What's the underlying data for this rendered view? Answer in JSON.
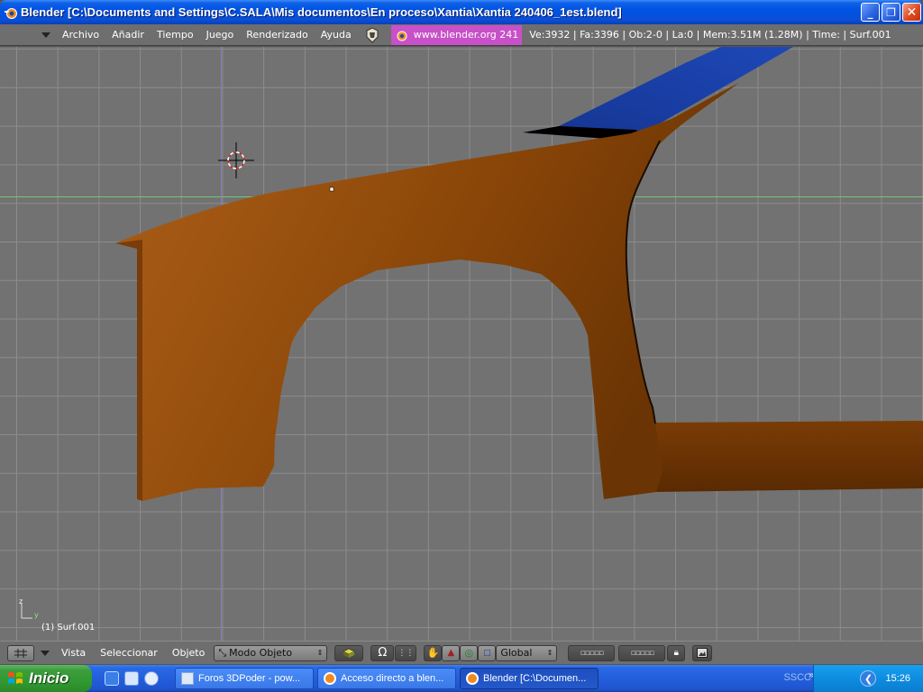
{
  "window": {
    "title": "Blender [C:\\Documents and Settings\\C.SALA\\Mis documentos\\En proceso\\Xantia\\Xantia 240406_1est.blend]",
    "minimize_label": "_",
    "maximize_label": "❐",
    "close_label": "✕"
  },
  "info_header": {
    "menus": [
      "Archivo",
      "Añadir",
      "Tiempo",
      "Juego",
      "Renderizado",
      "Ayuda"
    ],
    "url": "www.blender.org 241",
    "stats": "Ve:3932 | Fa:3396 | Ob:2-0 | La:0  | Mem:3.51M (1.28M)  | Time: | Surf.001"
  },
  "viewport": {
    "axis_z_label": "z",
    "axis_y_label": "y",
    "object_label": "(1) Surf.001",
    "colors": {
      "body": "#9a5010",
      "glass": "#1a3ea8",
      "grid_bg": "#727272"
    }
  },
  "view_header": {
    "menus": [
      "Vista",
      "Seleccionar",
      "Objeto"
    ],
    "mode": "Modo Objeto",
    "transform_orientation": "Global"
  },
  "taskbar": {
    "start_label": "Inicio",
    "tasks": [
      {
        "label": "Foros 3DPoder - pow...",
        "active": false
      },
      {
        "label": "Acceso directo a blen...",
        "active": false
      },
      {
        "label": "Blender [C:\\Documen...",
        "active": true
      }
    ],
    "tray_text": "SSCC",
    "tray_chevron": "»",
    "clock": "15:26"
  }
}
